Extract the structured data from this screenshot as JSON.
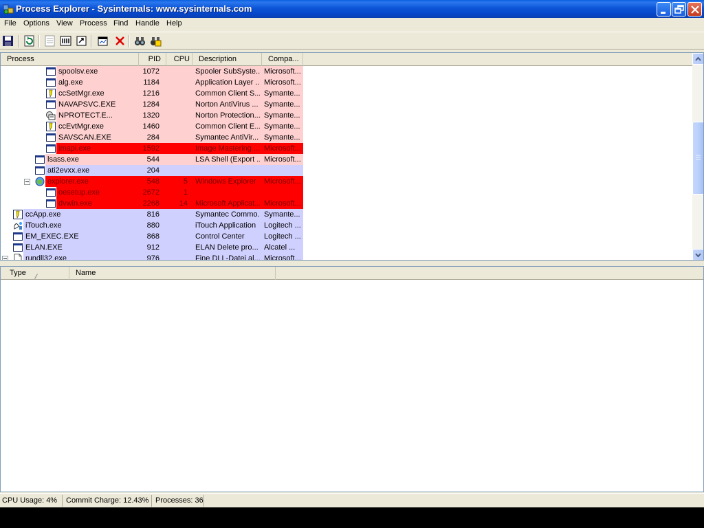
{
  "window": {
    "title": "Process Explorer - Sysinternals: www.sysinternals.com"
  },
  "menu": [
    "File",
    "Options",
    "View",
    "Process",
    "Find",
    "Handle",
    "Help"
  ],
  "toolbar": {
    "icons": [
      "save-icon",
      "refresh-icon",
      "properties-list-icon",
      "dll-view-icon",
      "handle-view-icon",
      "system-info-icon",
      "kill-process-icon",
      "find-icon",
      "find-dll-icon"
    ]
  },
  "process_table": {
    "columns": [
      "Process",
      "PID",
      "CPU",
      "Description",
      "Compa..."
    ],
    "rows": [
      {
        "name": "spoolsv.exe",
        "pid": "1072",
        "cpu": "",
        "desc": "Spooler SubSyste...",
        "company": "Microsoft...",
        "level": 4,
        "color": "#ffd0d0",
        "icon": "window-icon",
        "text_color": "#000000"
      },
      {
        "name": "alg.exe",
        "pid": "1184",
        "cpu": "",
        "desc": "Application Layer ...",
        "company": "Microsoft...",
        "level": 4,
        "color": "#ffd0d0",
        "icon": "window-icon",
        "text_color": "#000000"
      },
      {
        "name": "ccSetMgr.exe",
        "pid": "1216",
        "cpu": "",
        "desc": "Common Client S...",
        "company": "Symante...",
        "level": 4,
        "color": "#ffd0d0",
        "icon": "symantec-icon",
        "text_color": "#000000"
      },
      {
        "name": "NAVAPSVC.EXE",
        "pid": "1284",
        "cpu": "",
        "desc": "Norton AntiVirus ...",
        "company": "Symante...",
        "level": 4,
        "color": "#ffd0d0",
        "icon": "window-icon",
        "text_color": "#000000"
      },
      {
        "name": "NPROTECT.E...",
        "pid": "1320",
        "cpu": "",
        "desc": "Norton Protection...",
        "company": "Symante...",
        "level": 4,
        "color": "#ffd0d0",
        "icon": "shield-icon",
        "text_color": "#000000"
      },
      {
        "name": "ccEvtMgr.exe",
        "pid": "1460",
        "cpu": "",
        "desc": "Common Client E...",
        "company": "Symante...",
        "level": 4,
        "color": "#ffd0d0",
        "icon": "symantec-icon",
        "text_color": "#000000"
      },
      {
        "name": "SAVSCAN.EXE",
        "pid": "284",
        "cpu": "",
        "desc": "Symantec AntiVir...",
        "company": "Symante...",
        "level": 4,
        "color": "#ffd0d0",
        "icon": "window-icon",
        "text_color": "#000000"
      },
      {
        "name": "imapi.exe",
        "pid": "1592",
        "cpu": "",
        "desc": "Image Mastering ...",
        "company": "Microsoft...",
        "level": 4,
        "color": "#ff0000",
        "icon": "window-icon",
        "text_color": "#7a0000"
      },
      {
        "name": "lsass.exe",
        "pid": "544",
        "cpu": "",
        "desc": "LSA Shell (Export ...",
        "company": "Microsoft...",
        "level": 3,
        "color": "#ffd0d0",
        "icon": "window-icon",
        "text_color": "#000000"
      },
      {
        "name": "ati2evxx.exe",
        "pid": "204",
        "cpu": "",
        "desc": "",
        "company": "",
        "level": 3,
        "color": "#d0d0ff",
        "icon": "window-icon",
        "text_color": "#000000"
      },
      {
        "name": "explorer.exe",
        "pid": "548",
        "cpu": "5",
        "desc": "Windows Explorer",
        "company": "Microsoft...",
        "level": 3,
        "color": "#ff0000",
        "icon": "explorer-icon",
        "text_color": "#7a0000",
        "expander": true
      },
      {
        "name": "oesetup.exe",
        "pid": "2672",
        "cpu": "1",
        "desc": "",
        "company": "",
        "level": 4,
        "color": "#ff0000",
        "icon": "window-icon",
        "text_color": "#7a0000"
      },
      {
        "name": "dvwin.exe",
        "pid": "2268",
        "cpu": "14",
        "desc": "Microsoft Applicat...",
        "company": "Microsoft...",
        "level": 4,
        "color": "#ff0000",
        "icon": "window-icon",
        "text_color": "#7a0000"
      },
      {
        "name": "ccApp.exe",
        "pid": "816",
        "cpu": "",
        "desc": "Symantec Commo...",
        "company": "Symante...",
        "level": 1,
        "color": "#d0d0ff",
        "icon": "symantec-icon",
        "text_color": "#000000"
      },
      {
        "name": "iTouch.exe",
        "pid": "880",
        "cpu": "",
        "desc": "iTouch Application",
        "company": "Logitech ...",
        "level": 1,
        "color": "#d0d0ff",
        "icon": "itouch-icon",
        "text_color": "#000000"
      },
      {
        "name": "EM_EXEC.EXE",
        "pid": "868",
        "cpu": "",
        "desc": "Control Center",
        "company": "Logitech ...",
        "level": 1,
        "color": "#d0d0ff",
        "icon": "window-icon",
        "text_color": "#000000"
      },
      {
        "name": "ELAN.EXE",
        "pid": "912",
        "cpu": "",
        "desc": "ELAN Delete pro...",
        "company": "Alcatel ...",
        "level": 1,
        "color": "#d0d0ff",
        "icon": "window-icon",
        "text_color": "#000000"
      },
      {
        "name": "rundll32.exe",
        "pid": "976",
        "cpu": "",
        "desc": "Fine DLL-Datei al...",
        "company": "Microsoft...",
        "level": 1,
        "color": "#d0d0ff",
        "icon": "document-icon",
        "text_color": "#000000",
        "expander": true
      }
    ]
  },
  "lower_table": {
    "columns": [
      "Type",
      "Name"
    ],
    "sort_indicator": "/"
  },
  "status": {
    "cpu_usage": "CPU Usage: 4%",
    "commit_charge": "Commit Charge: 12.43%",
    "processes": "Processes: 36"
  }
}
